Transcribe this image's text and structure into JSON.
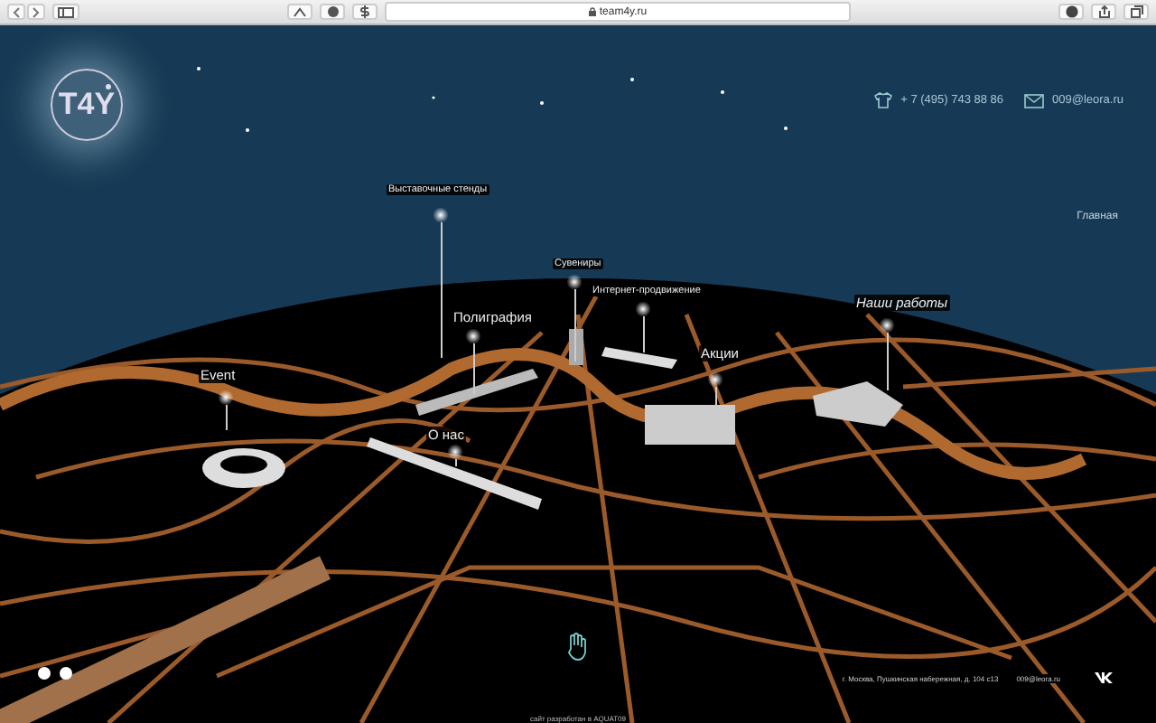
{
  "browser": {
    "url": "team4y.ru"
  },
  "header": {
    "logo": "T4Y",
    "phone": "+ 7 (495) 743 88 86",
    "email": "009@leora.ru",
    "nav": "Главная"
  },
  "map_labels": [
    {
      "label": "Выставочные стенды",
      "kind": "small"
    },
    {
      "label": "Сувениры",
      "kind": "small"
    },
    {
      "label": "Интернет-продвижение",
      "kind": "small"
    },
    {
      "label": "Полиграфия",
      "kind": "medium"
    },
    {
      "label": "Наши работы",
      "kind": "italic"
    },
    {
      "label": "Акции",
      "kind": "medium"
    },
    {
      "label": "Event",
      "kind": "medium"
    },
    {
      "label": "О нас",
      "kind": "medium"
    }
  ],
  "footer": {
    "address": "г. Москва, Пушкинская набережная, д. 104 с13",
    "email": "009@leora.ru",
    "credit": "сайт разработан в AQUAT09"
  }
}
